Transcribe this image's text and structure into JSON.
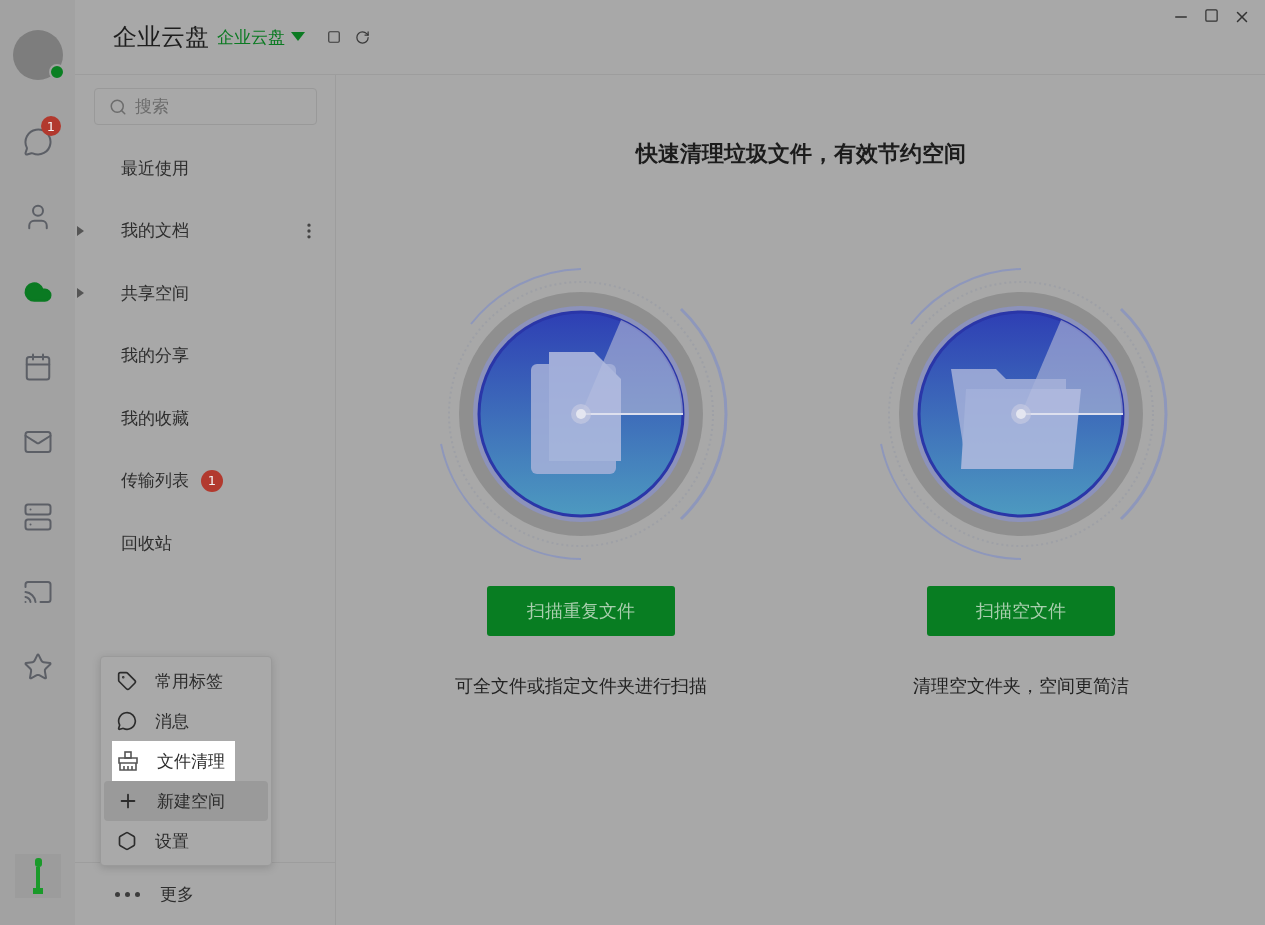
{
  "header": {
    "title": "企业云盘",
    "space_switch": "企业云盘"
  },
  "rail": {
    "user_online": true,
    "items": [
      {
        "kind": "chat",
        "selected": false,
        "badge": "1"
      },
      {
        "kind": "contacts",
        "selected": false
      },
      {
        "kind": "cloud",
        "selected": true
      },
      {
        "kind": "calendar",
        "selected": false
      },
      {
        "kind": "mail",
        "selected": false
      },
      {
        "kind": "server",
        "selected": false
      },
      {
        "kind": "screen",
        "selected": false
      },
      {
        "kind": "star",
        "selected": false
      }
    ]
  },
  "search": {
    "placeholder": "搜索"
  },
  "nav": [
    {
      "kind": "page",
      "label": "最近使用"
    },
    {
      "kind": "group",
      "label": "我的文档",
      "expanded": false,
      "has_more": true
    },
    {
      "kind": "group",
      "label": "共享空间",
      "expanded": false,
      "has_more": false
    },
    {
      "kind": "page",
      "label": "我的分享"
    },
    {
      "kind": "page",
      "label": "我的收藏"
    },
    {
      "kind": "page",
      "label": "传输列表",
      "badge": "1"
    },
    {
      "kind": "page",
      "label": "回收站"
    }
  ],
  "menu": {
    "items": [
      {
        "kind": "tag",
        "label": "常用标签",
        "spotlight": false,
        "hovered": false
      },
      {
        "kind": "message",
        "label": "消息",
        "spotlight": false,
        "hovered": false
      },
      {
        "kind": "clean",
        "label": "文件清理",
        "spotlight": true,
        "hovered": false
      },
      {
        "kind": "add",
        "label": "新建空间",
        "spotlight": false,
        "hovered": true
      },
      {
        "kind": "settings",
        "label": "设置",
        "spotlight": false,
        "hovered": false
      }
    ]
  },
  "more": {
    "label": "更多"
  },
  "main": {
    "heading": "快速清理垃圾文件，有效节约空间",
    "cards": [
      {
        "kind": "files",
        "button": "扫描重复文件",
        "caption": "可全文件或指定文件夹进行扫描"
      },
      {
        "kind": "folder",
        "button": "扫描空文件",
        "caption": "清理空文件夹，空间更简洁"
      }
    ]
  }
}
